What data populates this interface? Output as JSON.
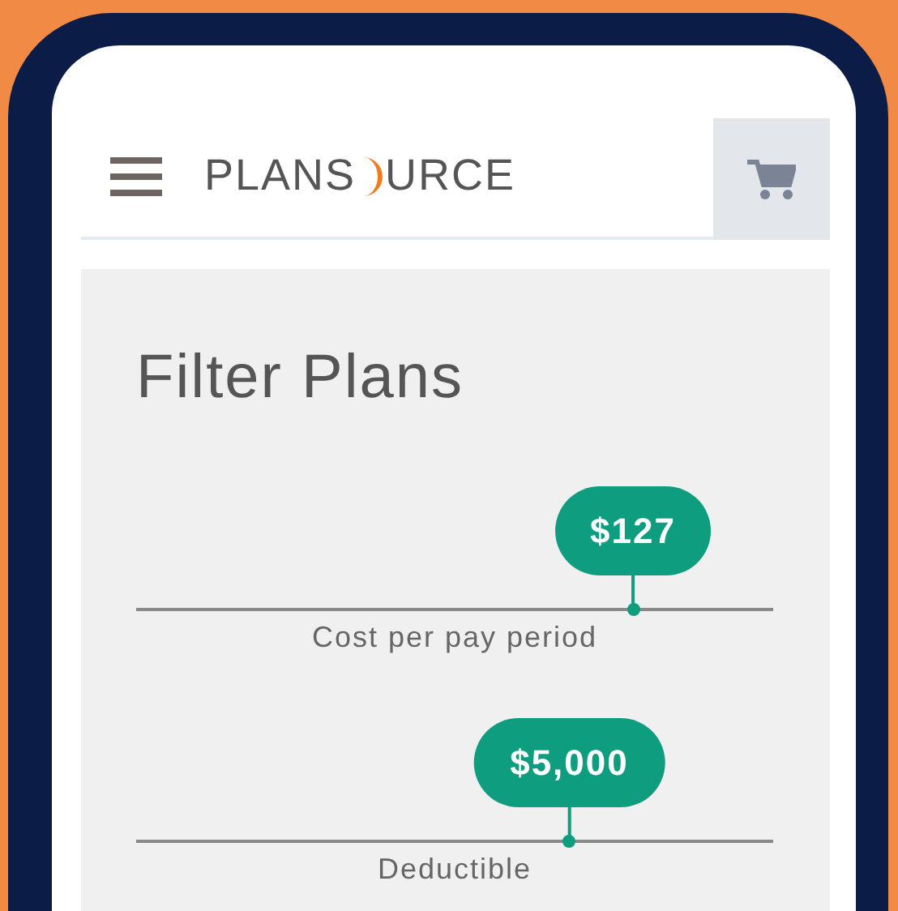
{
  "header": {
    "logo_left": "PLANS",
    "logo_right": "URCE"
  },
  "panel": {
    "title": "Filter Plans",
    "sliders": [
      {
        "value": "$127",
        "label": "Cost per pay period",
        "level": 0.78
      },
      {
        "value": "$5,000",
        "label": "Deductible",
        "level": 0.68
      }
    ]
  }
}
